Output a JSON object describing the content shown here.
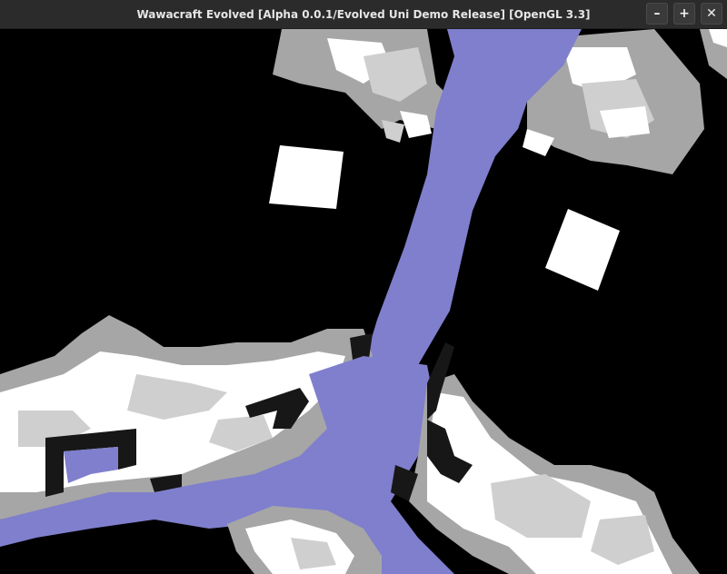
{
  "window": {
    "title": "Wawacraft Evolved [Alpha 0.0.1/Evolved Uni Demo Release] [OpenGL 3.3]",
    "minimize_glyph": "–",
    "maximize_glyph": "+",
    "close_glyph": "✕"
  },
  "colors": {
    "sky": "#000000",
    "water": "#7f7fcd",
    "snow_white": "#ffffff",
    "snow_light": "#cfcfcf",
    "snow_mid": "#a6a6a6",
    "shadow": "#171717",
    "titlebar": "#2b2b2b"
  }
}
